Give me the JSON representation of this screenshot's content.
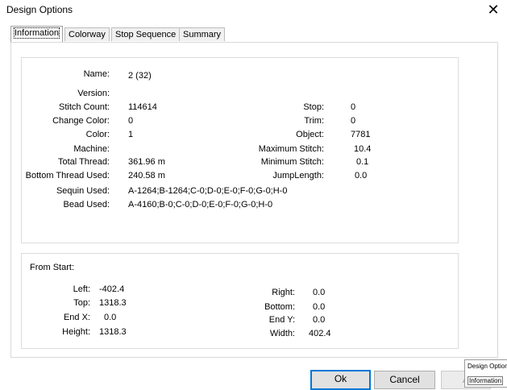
{
  "window": {
    "title": "Design Options"
  },
  "tabs": [
    "Information",
    "Colorway",
    "Stop Sequence",
    "Summary"
  ],
  "info": {
    "name_label": "Name:",
    "name_value": "2 (32)",
    "version_label": "Version:",
    "version_value": "",
    "stitch_count_label": "Stitch Count:",
    "stitch_count_value": "114614",
    "change_color_label": "Change Color:",
    "change_color_value": "0",
    "color_label": "Color:",
    "color_value": "1",
    "machine_label": "Machine:",
    "machine_value": "",
    "total_thread_label": "Total Thread:",
    "total_thread_value": "361.96 m",
    "bottom_thread_label": "Bottom Thread Used:",
    "bottom_thread_value": "240.58 m",
    "sequin_label": "Sequin Used:",
    "sequin_value": "A-1264;B-1264;C-0;D-0;E-0;F-0;G-0;H-0",
    "bead_label": "Bead Used:",
    "bead_value": "A-4160;B-0;C-0;D-0;E-0;F-0;G-0;H-0",
    "stop_label": "Stop:",
    "stop_value": "0",
    "trim_label": "Trim:",
    "trim_value": "0",
    "object_label": "Object:",
    "object_value": "7781",
    "max_stitch_label": "Maximum Stitch:",
    "max_stitch_value": "10.4",
    "min_stitch_label": "Minimum Stitch:",
    "min_stitch_value": "0.1",
    "jump_length_label": "JumpLength:",
    "jump_length_value": "0.0"
  },
  "from_start": {
    "heading": "From Start:",
    "left_label": "Left:",
    "left_value": "-402.4",
    "top_label": "Top:",
    "top_value": "1318.3",
    "endx_label": "End X:",
    "endx_value": "0.0",
    "height_label": "Height:",
    "height_value": "1318.3",
    "right_label": "Right:",
    "right_value": "0.0",
    "bottom_label": "Bottom:",
    "bottom_value": "0.0",
    "endy_label": "End Y:",
    "endy_value": "0.0",
    "width_label": "Width:",
    "width_value": "402.4"
  },
  "buttons": {
    "ok": "Ok",
    "cancel": "Cancel",
    "apply": "A"
  },
  "popup": {
    "title": "Design Option",
    "tab": "Information"
  }
}
